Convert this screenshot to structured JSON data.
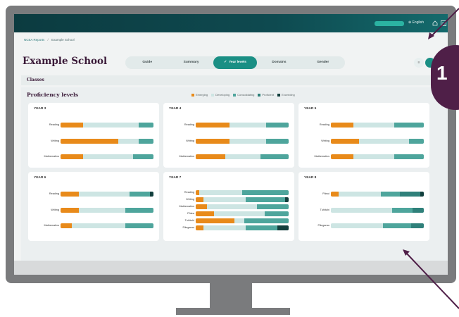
{
  "header": {
    "language": "English"
  },
  "breadcrumb": {
    "root": "NCEA Reports",
    "current": "Example School"
  },
  "school": {
    "title": "Example School"
  },
  "tabs": [
    {
      "label": "Guide",
      "active": false
    },
    {
      "label": "Summary",
      "active": false
    },
    {
      "label": "Year levels",
      "active": true
    },
    {
      "label": "Domains",
      "active": false
    },
    {
      "label": "Gender",
      "active": false
    }
  ],
  "classes_label": "Classes",
  "proficiency": {
    "title": "Proficiency levels",
    "legend": [
      {
        "label": "Emerging",
        "color": "#e88a1a"
      },
      {
        "label": "Developing",
        "color": "#cde5e3"
      },
      {
        "label": "Consolidating",
        "color": "#4ea59c"
      },
      {
        "label": "Proficient",
        "color": "#2f807a"
      },
      {
        "label": "Exceeding",
        "color": "#123f3d"
      }
    ]
  },
  "cards": [
    {
      "title": "YEAR 3",
      "rows": [
        {
          "label": "Reading",
          "values": [
            0.24,
            0.6,
            0.16,
            0,
            0
          ]
        },
        {
          "label": "Writing",
          "values": [
            0.62,
            0.22,
            0.16,
            0,
            0
          ]
        },
        {
          "label": "Mathematics",
          "values": [
            0.24,
            0.54,
            0.22,
            0,
            0
          ]
        }
      ]
    },
    {
      "title": "YEAR 4",
      "rows": [
        {
          "label": "Reading",
          "values": [
            0.36,
            0.4,
            0.24,
            0,
            0
          ]
        },
        {
          "label": "Writing",
          "values": [
            0.36,
            0.4,
            0.24,
            0,
            0
          ]
        },
        {
          "label": "Mathematics",
          "values": [
            0.32,
            0.38,
            0.3,
            0,
            0
          ]
        }
      ]
    },
    {
      "title": "YEAR 5",
      "rows": [
        {
          "label": "Reading",
          "values": [
            0.24,
            0.44,
            0.32,
            0,
            0
          ]
        },
        {
          "label": "Writing",
          "values": [
            0.3,
            0.54,
            0.16,
            0,
            0
          ]
        },
        {
          "label": "Mathematics",
          "values": [
            0.24,
            0.44,
            0.32,
            0,
            0
          ]
        }
      ]
    },
    {
      "title": "YEAR 6",
      "rows": [
        {
          "label": "Reading",
          "values": [
            0.2,
            0.54,
            0.22,
            0,
            0.04
          ]
        },
        {
          "label": "Writing",
          "values": [
            0.2,
            0.5,
            0.3,
            0,
            0
          ]
        },
        {
          "label": "Mathematics",
          "values": [
            0.12,
            0.58,
            0.3,
            0,
            0
          ]
        }
      ]
    },
    {
      "title": "YEAR 7",
      "rows": [
        {
          "label": "Reading",
          "values": [
            0.04,
            0.46,
            0.5,
            0,
            0
          ]
        },
        {
          "label": "Writing",
          "values": [
            0.08,
            0.46,
            0.42,
            0,
            0.04
          ]
        },
        {
          "label": "Mathematics",
          "values": [
            0.12,
            0.54,
            0.34,
            0,
            0
          ]
        },
        {
          "label": "Pūtea",
          "values": [
            0.2,
            0.54,
            0.26,
            0,
            0
          ]
        },
        {
          "label": "Tuhituhi",
          "values": [
            0.42,
            0.1,
            0.48,
            0,
            0
          ]
        },
        {
          "label": "Pāngarau",
          "values": [
            0.08,
            0.46,
            0.34,
            0,
            0.12
          ]
        }
      ]
    },
    {
      "title": "YEAR 8",
      "rows": [
        {
          "label": "Pānui",
          "values": [
            0.08,
            0.46,
            0.2,
            0.22,
            0.04
          ]
        },
        {
          "label": "Tuhituhi",
          "values": [
            0,
            0.66,
            0.22,
            0.12,
            0
          ]
        },
        {
          "label": "Pāngarau",
          "values": [
            0,
            0.56,
            0.3,
            0.14,
            0
          ]
        }
      ]
    }
  ],
  "callout_number": "1"
}
